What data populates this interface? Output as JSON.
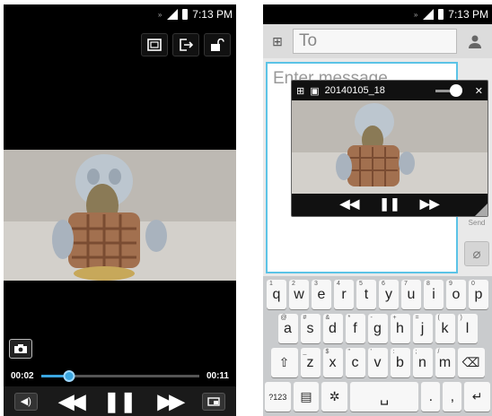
{
  "left_phone": {
    "status_time": "7:13 PM",
    "time_elapsed": "00:02",
    "time_total": "00:11",
    "progress_fraction": 0.18
  },
  "right_phone": {
    "status_time": "7:13 PM",
    "to_placeholder": "To",
    "message_placeholder": "Enter message",
    "send_label": "Send",
    "popup_title": "20140105_18",
    "volume_fraction": 0.82,
    "keyboard": {
      "row1": [
        [
          "q",
          "1"
        ],
        [
          "w",
          "2"
        ],
        [
          "e",
          "3"
        ],
        [
          "r",
          "4"
        ],
        [
          "t",
          "5"
        ],
        [
          "y",
          "6"
        ],
        [
          "u",
          "7"
        ],
        [
          "i",
          "8"
        ],
        [
          "o",
          "9"
        ],
        [
          "p",
          "0"
        ]
      ],
      "row2": [
        [
          "a",
          "@"
        ],
        [
          "s",
          "#"
        ],
        [
          "d",
          "&"
        ],
        [
          "f",
          "*"
        ],
        [
          "g",
          "-"
        ],
        [
          "h",
          "+"
        ],
        [
          "j",
          "="
        ],
        [
          "k",
          "("
        ],
        [
          "l",
          ")"
        ]
      ],
      "row3": [
        [
          "z",
          "_"
        ],
        [
          "x",
          "$"
        ],
        [
          "c",
          "\""
        ],
        [
          "v",
          "'"
        ],
        [
          "b",
          ":"
        ],
        [
          "n",
          ";"
        ],
        [
          "m",
          "/"
        ]
      ],
      "mode_key": "?123",
      "period": ".",
      "comma": ","
    }
  }
}
